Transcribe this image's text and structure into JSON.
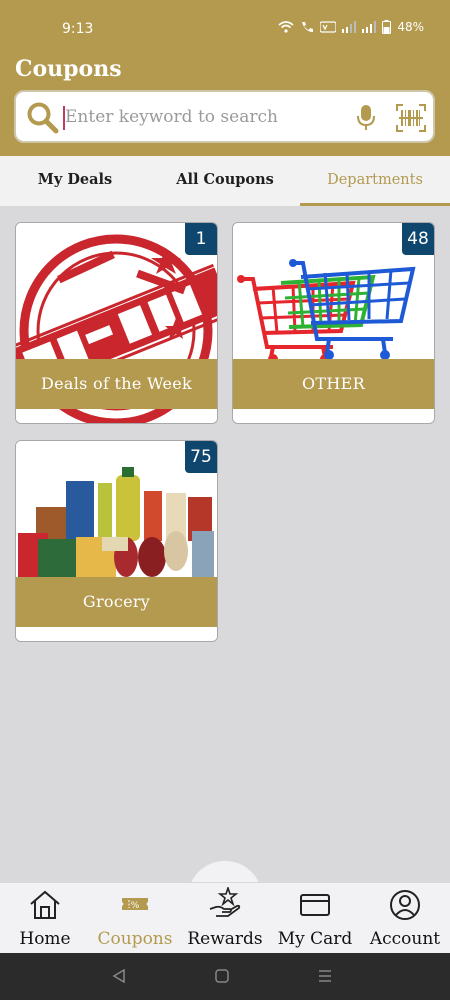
{
  "status_bar": {
    "time": "9:13",
    "battery": "48%"
  },
  "header": {
    "title": "Coupons"
  },
  "search": {
    "placeholder": "Enter keyword to search"
  },
  "tabs": [
    {
      "label": "My Deals",
      "active": false
    },
    {
      "label": "All Coupons",
      "active": false
    },
    {
      "label": "Departments",
      "active": true
    }
  ],
  "departments": [
    {
      "label": "Deals of the Week",
      "count": "1",
      "image": "deal-of-the-week-stamp"
    },
    {
      "label": "OTHER",
      "count": "48",
      "image": "shopping-carts"
    },
    {
      "label": "Grocery",
      "count": "75",
      "image": "grocery-products"
    }
  ],
  "bottom_nav": [
    {
      "label": "Home",
      "icon": "home-icon",
      "active": false
    },
    {
      "label": "Coupons",
      "icon": "coupon-icon",
      "active": true
    },
    {
      "label": "Rewards",
      "icon": "rewards-icon",
      "active": false
    },
    {
      "label": "My Card",
      "icon": "card-icon",
      "active": false
    },
    {
      "label": "Account",
      "icon": "account-icon",
      "active": false
    }
  ],
  "colors": {
    "brand_gold": "#b39a4f",
    "badge_navy": "#0f466d"
  }
}
